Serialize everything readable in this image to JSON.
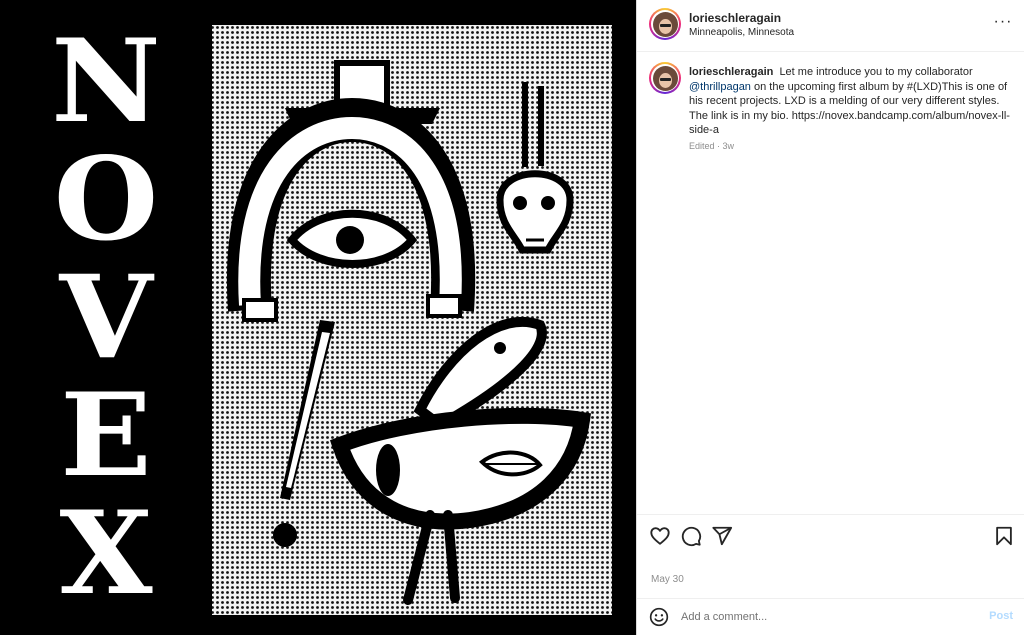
{
  "post": {
    "image": {
      "description_icon": "artwork-image",
      "title_letters": [
        "N",
        "O",
        "V",
        "E",
        "X"
      ]
    },
    "header": {
      "username": "lorieschleragain",
      "location": "Minneapolis, Minnesota",
      "more_icon": "more-horizontal-icon",
      "more_label": "···"
    },
    "caption": {
      "username": "lorieschleragain",
      "text_before": "Let me introduce you to my collaborator",
      "mention": "@thrillpagan",
      "text_after": "on the upcoming first album by #(LXD)This is one of his recent projects. LXD is a melding of our very different styles. The link is in my bio. https://novex.bandcamp.com/album/novex-ll-side-a",
      "meta": "Edited · 3w"
    },
    "actions": {
      "like_icon": "heart-icon",
      "comment_icon": "comment-icon",
      "share_icon": "send-icon",
      "save_icon": "bookmark-icon"
    },
    "date": "May 30",
    "comment_box": {
      "emoji_icon": "emoji-icon",
      "placeholder": "Add a comment...",
      "post_label": "Post"
    }
  },
  "colors": {
    "link": "#00376b",
    "post_button_disabled": "#b3dbff",
    "meta_text": "#8e8e8e"
  }
}
